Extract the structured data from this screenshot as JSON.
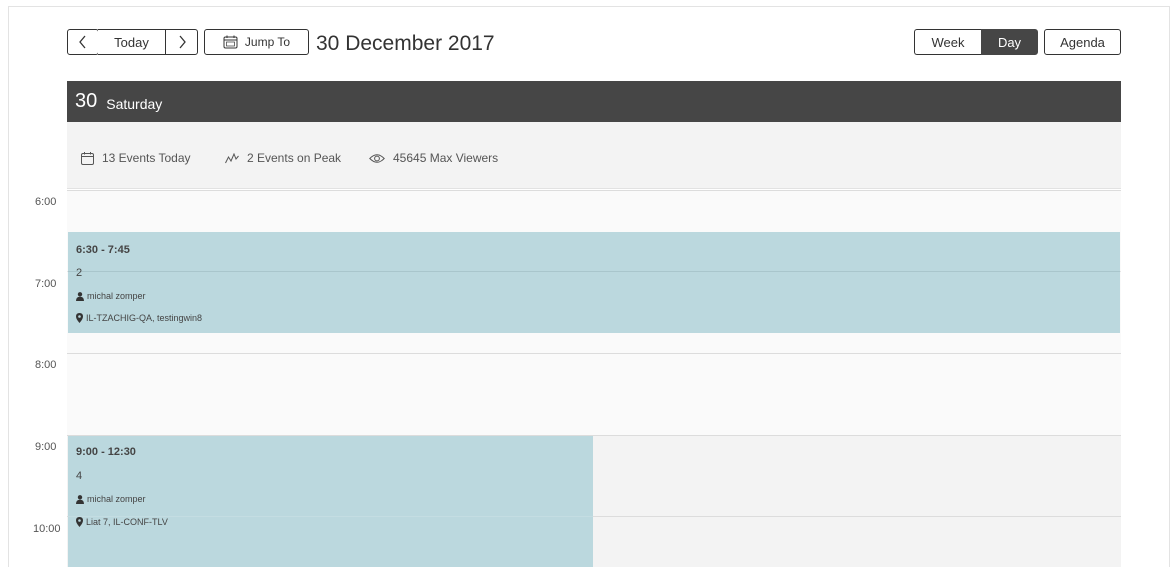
{
  "toolbar": {
    "today_label": "Today",
    "jump_label": "Jump To",
    "current_date": "30 December 2017",
    "views": [
      "Week",
      "Day",
      "Agenda"
    ],
    "active_view": "Day"
  },
  "day": {
    "number": "30",
    "name": "Saturday"
  },
  "stats": {
    "events_today": "13 Events Today",
    "events_peak": "2 Events on Peak",
    "max_viewers": "45645 Max Viewers"
  },
  "hours": [
    "6:00",
    "7:00",
    "8:00",
    "9:00",
    "10:00"
  ],
  "events": [
    {
      "time": "6:30 - 7:45",
      "title": "2",
      "organizer": "michal zomper",
      "location": "IL-TZACHIG-QA, testingwin8"
    },
    {
      "time": "9:00 - 12:30",
      "title": "4",
      "organizer": "michal zomper",
      "location": "Liat 7, IL-CONF-TLV"
    }
  ],
  "colors": {
    "header_bg": "#464646",
    "event_bg": "#bbd8de",
    "active_view_bg": "#464646"
  }
}
